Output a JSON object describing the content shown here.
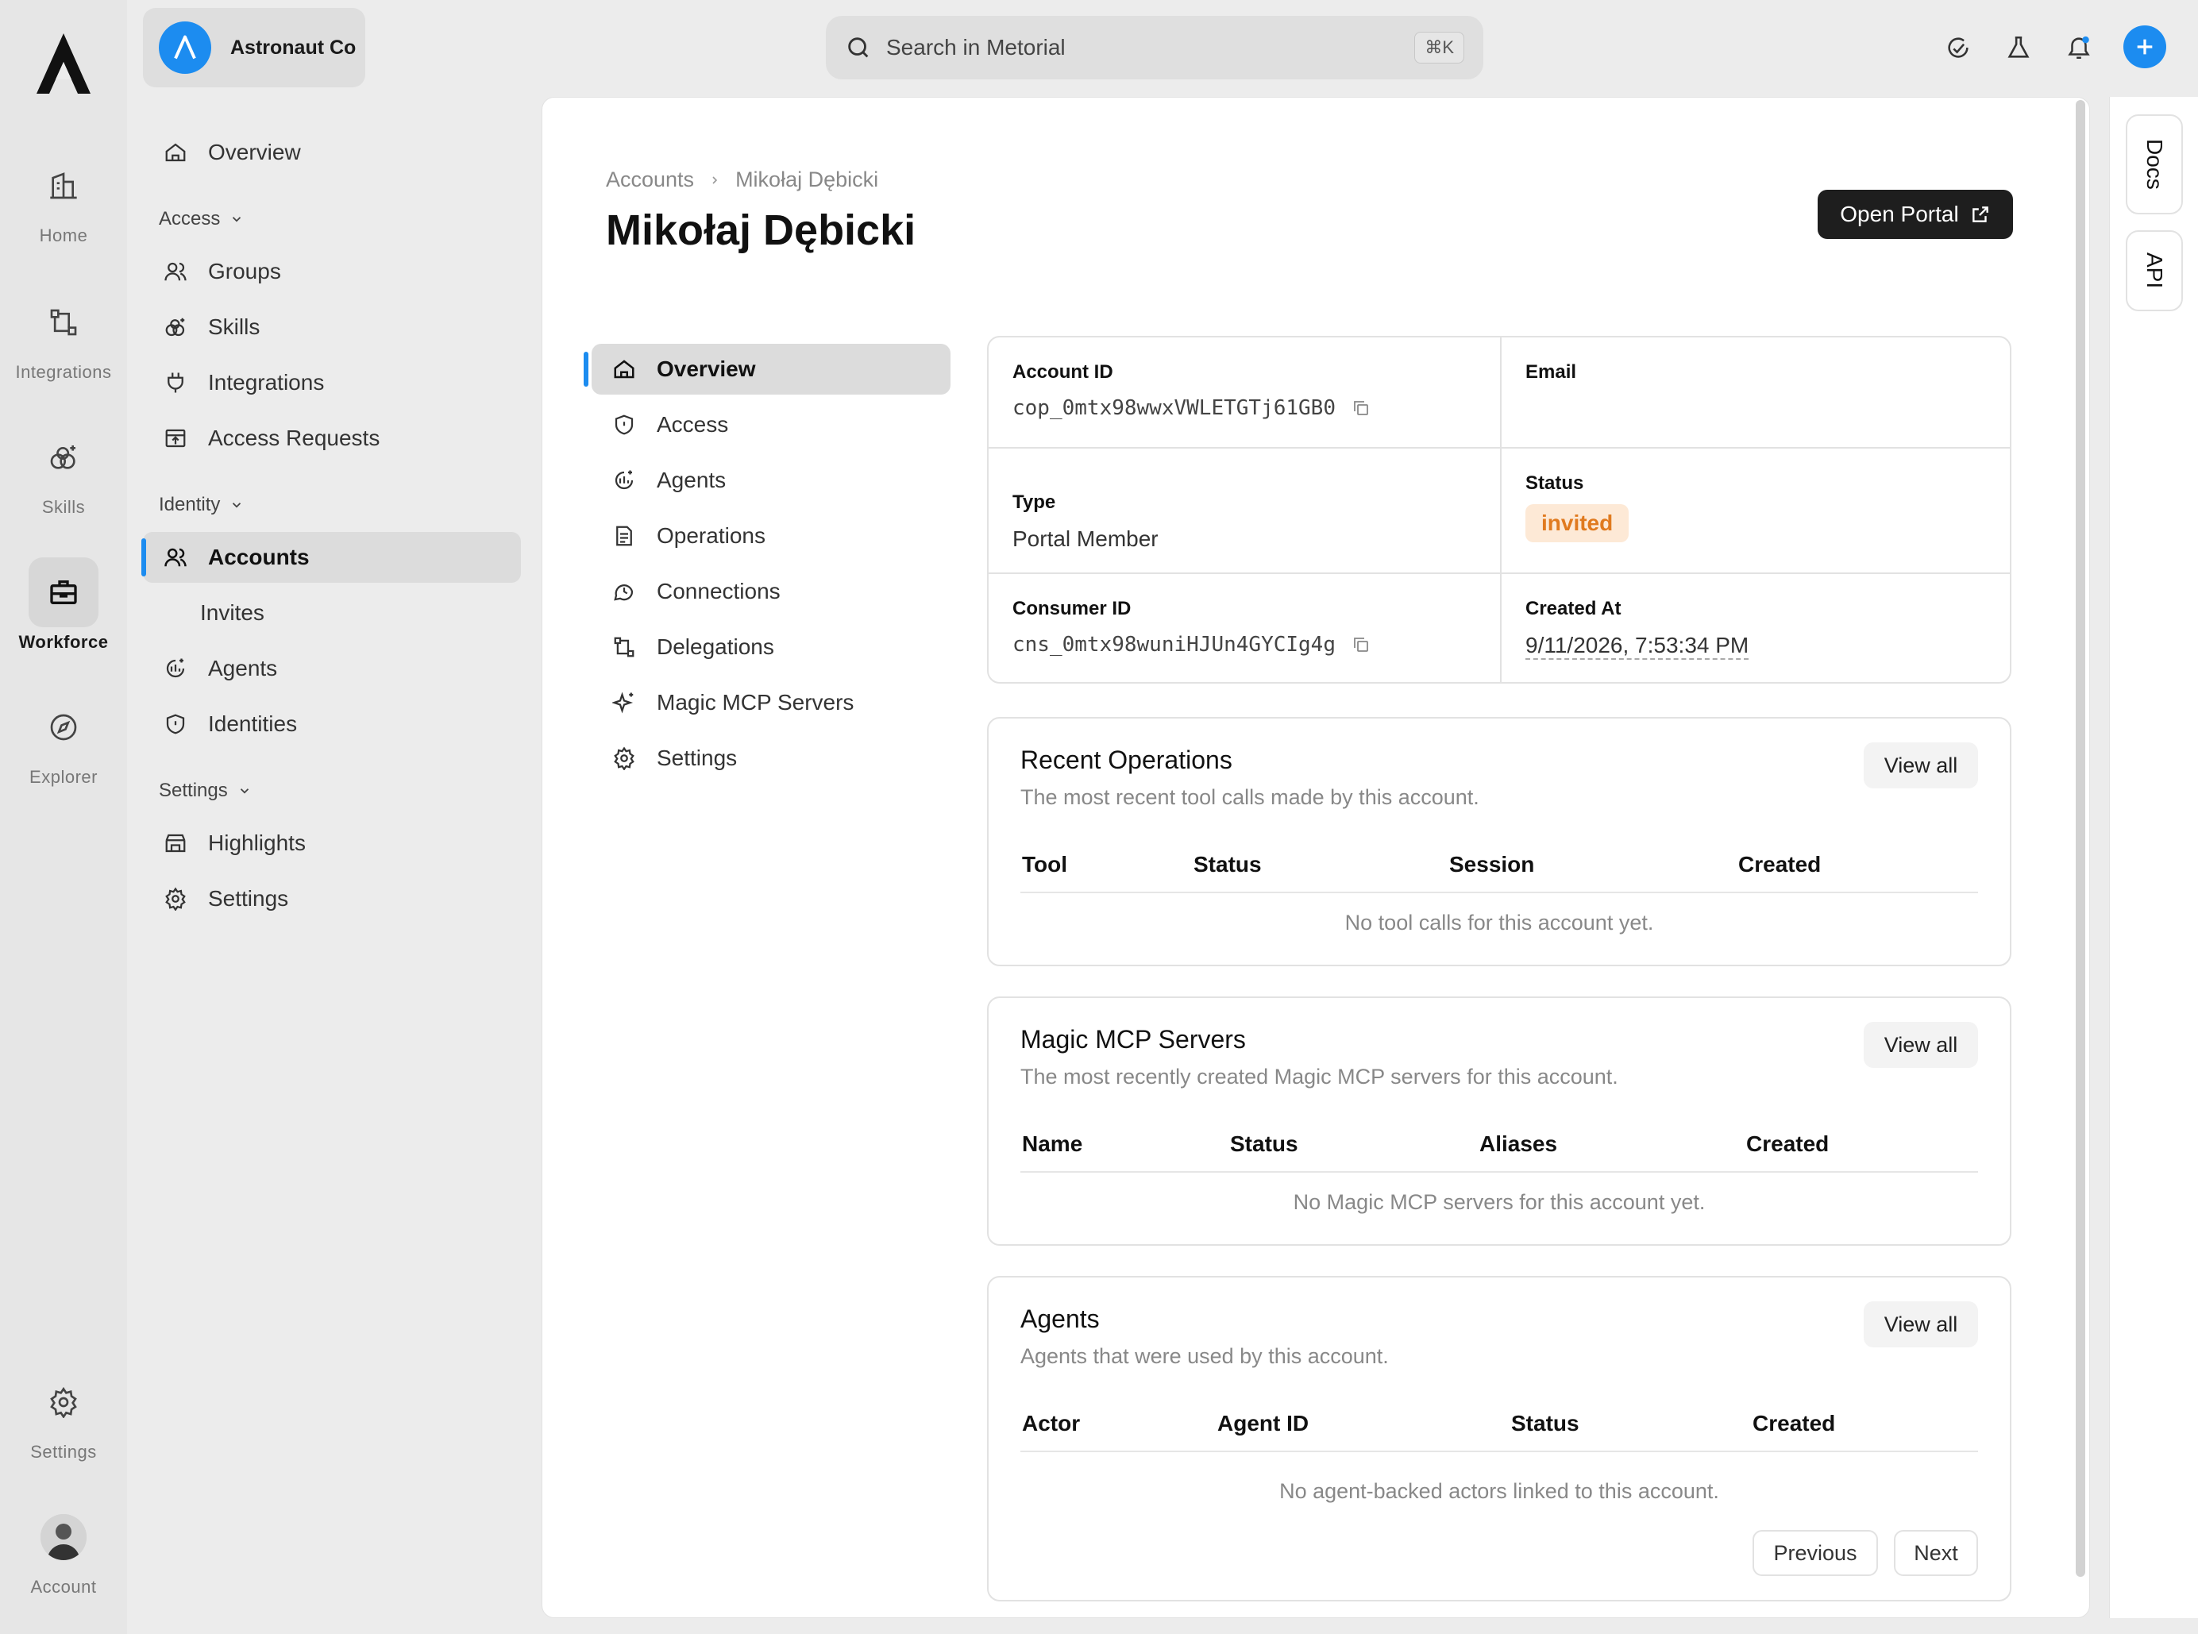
{
  "rail": {
    "items": [
      {
        "label": "Home",
        "icon": "building-icon"
      },
      {
        "label": "Integrations",
        "icon": "workflow-icon"
      },
      {
        "label": "Skills",
        "icon": "skills-icon"
      },
      {
        "label": "Workforce",
        "icon": "briefcase-icon"
      },
      {
        "label": "Explorer",
        "icon": "compass-icon"
      }
    ],
    "settings_label": "Settings",
    "account_label": "Account"
  },
  "org": {
    "name": "Astronaut Co"
  },
  "sidenav": {
    "overview": "Overview",
    "access_group": "Access",
    "access_items": [
      "Groups",
      "Skills",
      "Integrations",
      "Access Requests"
    ],
    "identity_group": "Identity",
    "accounts": "Accounts",
    "invites": "Invites",
    "identity_items": [
      "Agents",
      "Identities"
    ],
    "settings_group": "Settings",
    "settings_items": [
      "Highlights",
      "Settings"
    ]
  },
  "search": {
    "placeholder": "Search in Metorial",
    "shortcut": "⌘K"
  },
  "colors": {
    "accent": "#1c8cf0",
    "status_invited_bg": "#fde9d6",
    "status_invited_fg": "#e07a1f"
  },
  "page": {
    "breadcrumb": [
      "Accounts",
      "Mikołaj Dębicki"
    ],
    "title": "Mikołaj Dębicki",
    "open_portal": "Open Portal"
  },
  "subnav": [
    "Overview",
    "Access",
    "Agents",
    "Operations",
    "Connections",
    "Delegations",
    "Magic MCP Servers",
    "Settings"
  ],
  "info": {
    "account_id_label": "Account ID",
    "account_id": "cop_0mtx98wwxVWLETGTj61GB0",
    "email_label": "Email",
    "email": "",
    "type_label": "Type",
    "type": "Portal Member",
    "status_label": "Status",
    "status": "invited",
    "consumer_id_label": "Consumer ID",
    "consumer_id": "cns_0mtx98wuniHJUn4GYCIg4g",
    "created_at_label": "Created At",
    "created_at": "9/11/2026, 7:53:34 PM"
  },
  "recent_operations": {
    "title": "Recent Operations",
    "description": "The most recent tool calls made by this account.",
    "view_all": "View all",
    "columns": [
      "Tool",
      "Status",
      "Session",
      "Created"
    ],
    "empty": "No tool calls for this account yet."
  },
  "magic_mcp": {
    "title": "Magic MCP Servers",
    "description": "The most recently created Magic MCP servers for this account.",
    "view_all": "View all",
    "columns": [
      "Name",
      "Status",
      "Aliases",
      "Created"
    ],
    "empty": "No Magic MCP servers for this account yet."
  },
  "agents": {
    "title": "Agents",
    "description": "Agents that were used by this account.",
    "view_all": "View all",
    "columns": [
      "Actor",
      "Agent ID",
      "Status",
      "Created"
    ],
    "empty": "No agent-backed actors linked to this account.",
    "previous": "Previous",
    "next": "Next"
  },
  "docrail": {
    "docs": "Docs",
    "api": "API"
  }
}
